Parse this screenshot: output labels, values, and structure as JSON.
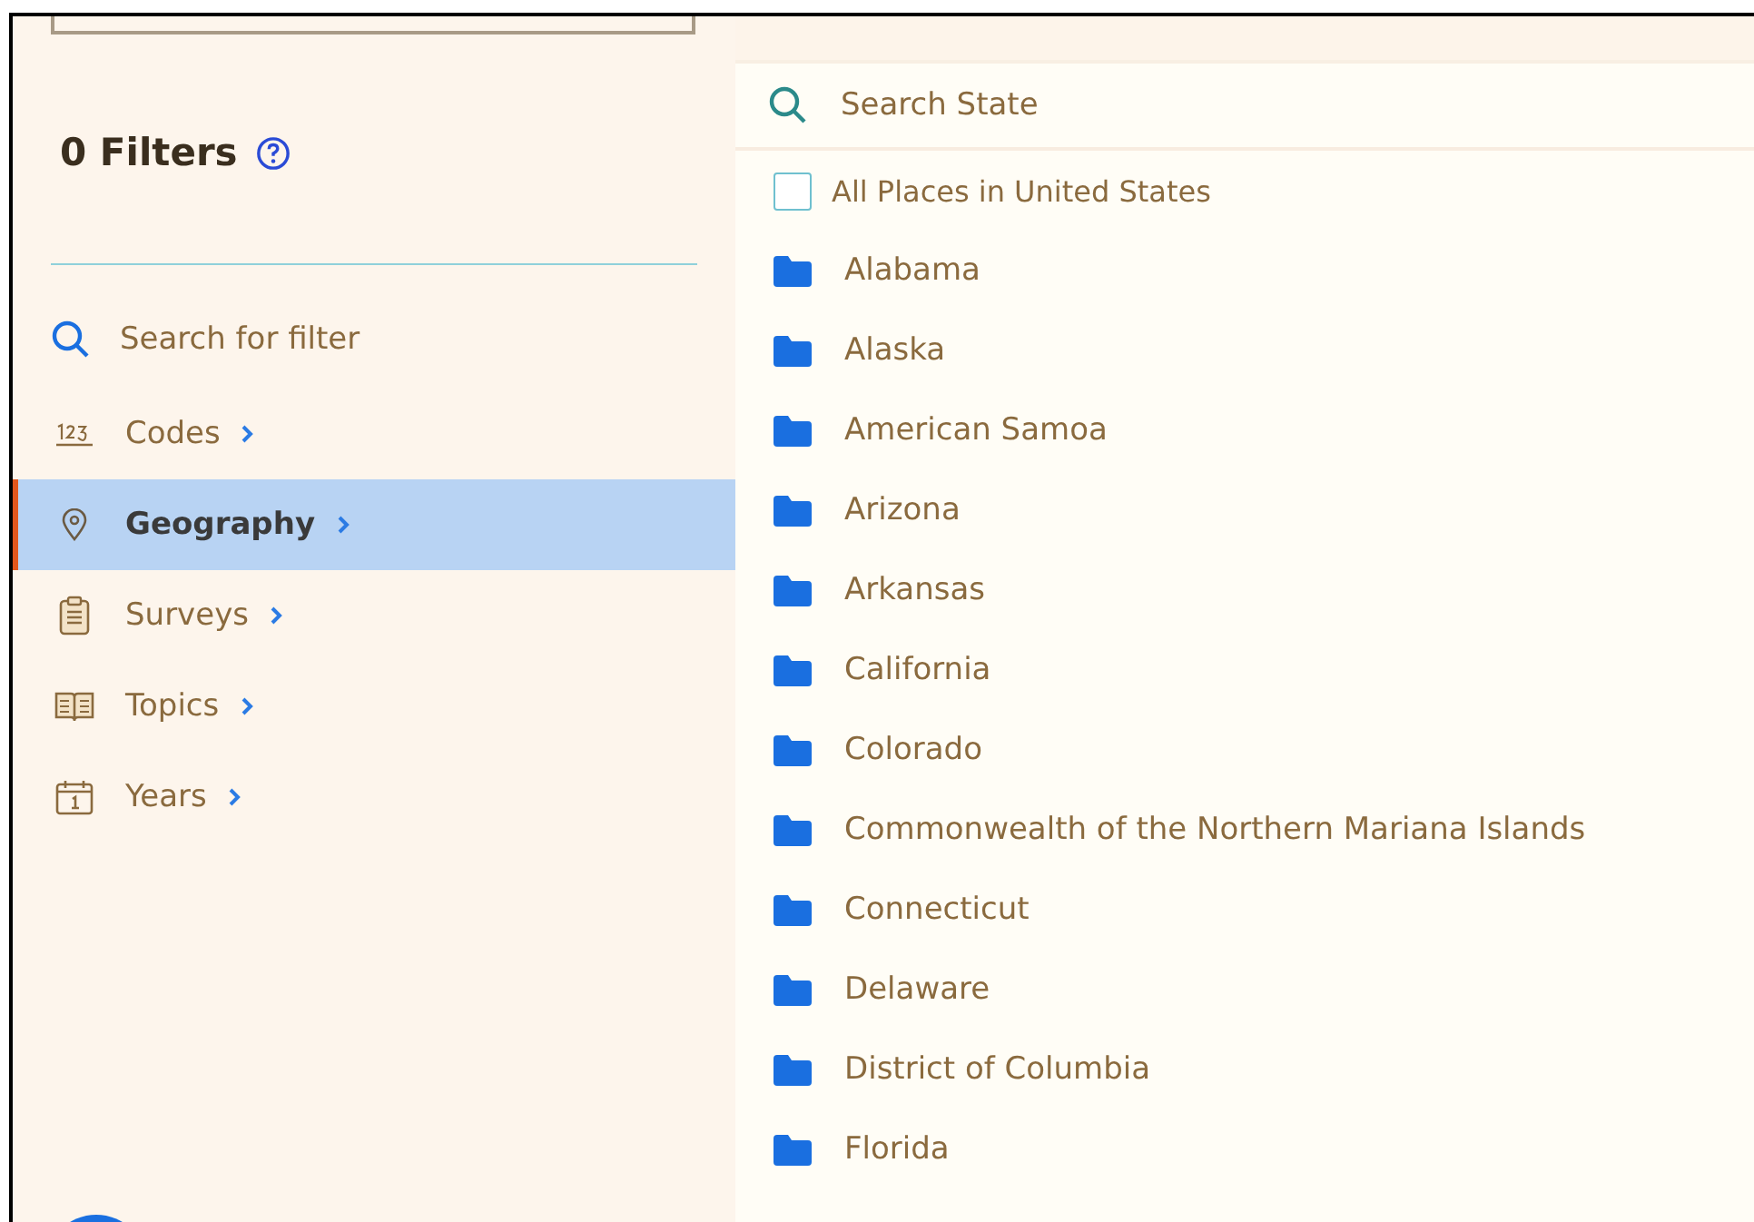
{
  "filters": {
    "title": "0 Filters"
  },
  "sidebar": {
    "search": {
      "placeholder": "Search for filter"
    },
    "items": [
      {
        "kind": "codes",
        "label": "Codes",
        "selected": false
      },
      {
        "kind": "geography",
        "label": "Geography",
        "selected": true
      },
      {
        "kind": "surveys",
        "label": "Surveys",
        "selected": false
      },
      {
        "kind": "topics",
        "label": "Topics",
        "selected": false
      },
      {
        "kind": "years",
        "label": "Years",
        "selected": false
      }
    ]
  },
  "state_search": {
    "placeholder": "Search State"
  },
  "all_places": {
    "label": "All Places in United States",
    "checked": false
  },
  "states": [
    "Alabama",
    "Alaska",
    "American Samoa",
    "Arizona",
    "Arkansas",
    "California",
    "Colorado",
    "Commonwealth of the Northern Mariana Islands",
    "Connecticut",
    "Delaware",
    "District of Columbia",
    "Florida"
  ]
}
